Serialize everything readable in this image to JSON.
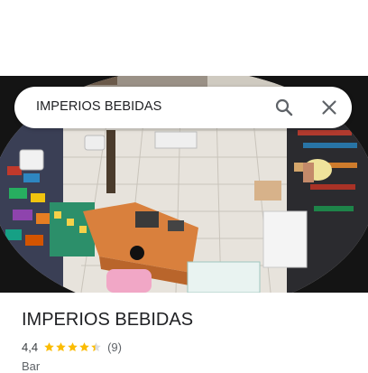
{
  "search": {
    "query": "IMPERIOS BEBIDAS",
    "search_icon": "search-icon",
    "close_icon": "close-icon"
  },
  "photo": {
    "description_icon": "fisheye-store-photo"
  },
  "place": {
    "title": "IMPERIOS BEBIDAS",
    "rating": "4,4",
    "stars": 4.4,
    "review_count": "(9)",
    "category": "Bar"
  },
  "colors": {
    "star": "#fbbc04",
    "star_empty": "#dadce0",
    "text_primary": "#202124",
    "text_secondary": "#5f6368"
  }
}
